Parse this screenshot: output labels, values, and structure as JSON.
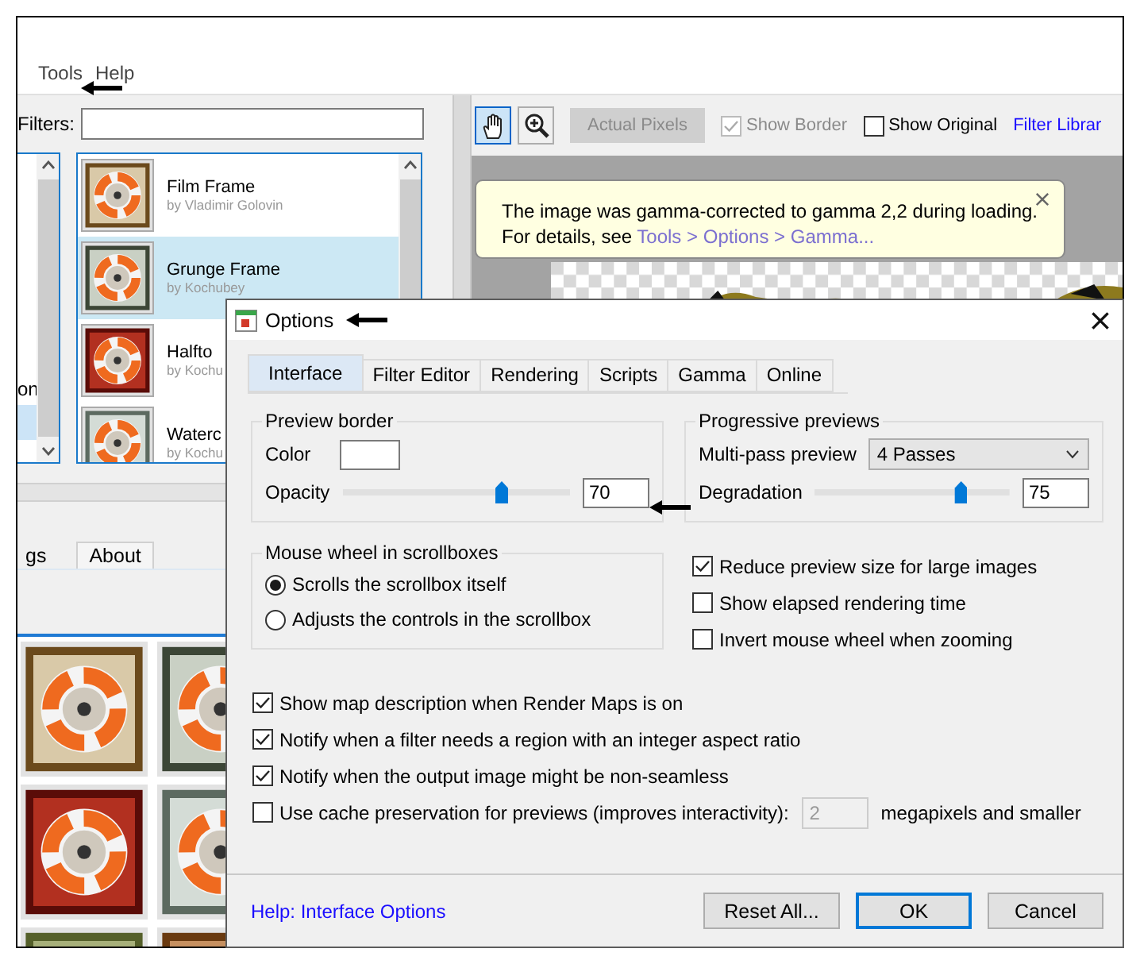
{
  "menu": [
    {
      "label": "Tools"
    },
    {
      "label": "Help"
    }
  ],
  "filters": {
    "label": "Filters:"
  },
  "category_list": {
    "items": [
      {
        "label": "on",
        "selected": false
      },
      {
        "selected": true
      }
    ]
  },
  "filter_list": {
    "items": [
      {
        "title": "Film Frame",
        "author": "by Vladimir Golovin",
        "selected": false
      },
      {
        "title": "Grunge Frame",
        "author": "by Kochubey",
        "selected": true
      },
      {
        "title": "Halfto",
        "author": "by Kochu",
        "selected": false
      },
      {
        "title": "Waterc",
        "author": "by Kochu",
        "selected": false
      }
    ]
  },
  "panel_tabs": [
    {
      "label": "gs",
      "selected": false
    },
    {
      "label": "About",
      "selected": true
    }
  ],
  "toolbar": {
    "tools": [
      {
        "kind": "hand",
        "selected": true
      },
      {
        "kind": "zoom",
        "selected": false
      }
    ],
    "actual_pixels": {
      "label": "Actual Pixels",
      "disabled": true
    },
    "show_border": {
      "label": "Show Border",
      "checked": true,
      "disabled": true
    },
    "show_original": {
      "label": "Show Original",
      "checked": false,
      "disabled": false
    },
    "link": "Filter Librar"
  },
  "notice": {
    "message": "The image was gamma-corrected to gamma 2,2 during loading.",
    "details_prefix": "For details, see",
    "details_link": "Tools > Options > Gamma..."
  },
  "dialog": {
    "title": "Options",
    "tabs": [
      {
        "label": "Interface",
        "selected": true
      },
      {
        "label": "Filter Editor",
        "selected": false
      },
      {
        "label": "Rendering",
        "selected": false
      },
      {
        "label": "Scripts",
        "selected": false
      },
      {
        "label": "Gamma",
        "selected": false
      },
      {
        "label": "Online",
        "selected": false
      }
    ],
    "preview_border": {
      "title": "Preview border",
      "color_label": "Color",
      "opacity_label": "Opacity",
      "opacity": {
        "level": 0.7,
        "value": "70"
      }
    },
    "progressive_previews": {
      "title": "Progressive previews",
      "multipass_label": "Multi-pass preview",
      "multipass_value": "4 Passes",
      "degradation_label": "Degradation",
      "degradation": {
        "level": 0.75,
        "value": "75"
      }
    },
    "mouse_wheel": {
      "title": "Mouse wheel in scrollboxes",
      "options": [
        {
          "label": "Scrolls the scrollbox itself",
          "selected": true
        },
        {
          "label": "Adjusts the controls in the scrollbox",
          "selected": false
        }
      ]
    },
    "side_options": [
      {
        "label": "Reduce preview size for large images",
        "checked": true
      },
      {
        "label": "Show elapsed rendering time",
        "checked": false
      },
      {
        "label": "Invert mouse wheel when zooming",
        "checked": false
      }
    ],
    "options": [
      {
        "kind": "plain",
        "label": "Show map description when Render Maps is on",
        "checked": true
      },
      {
        "kind": "plain",
        "label": "Notify when a filter needs a region with an integer aspect ratio",
        "checked": true
      },
      {
        "kind": "plain",
        "label": "Notify when the output image might be non-seamless",
        "checked": true
      },
      {
        "kind": "with_field",
        "label": "Use cache preservation for previews (improves interactivity):",
        "checked": false,
        "field_value": "2",
        "field_disabled": true,
        "suffix": "megapixels and smaller"
      }
    ],
    "help_link": "Help: Interface Options",
    "buttons": [
      {
        "label": "Reset All...",
        "kind": "normal"
      },
      {
        "label": "OK",
        "kind": "default"
      },
      {
        "label": "Cancel",
        "kind": "normal"
      }
    ]
  }
}
